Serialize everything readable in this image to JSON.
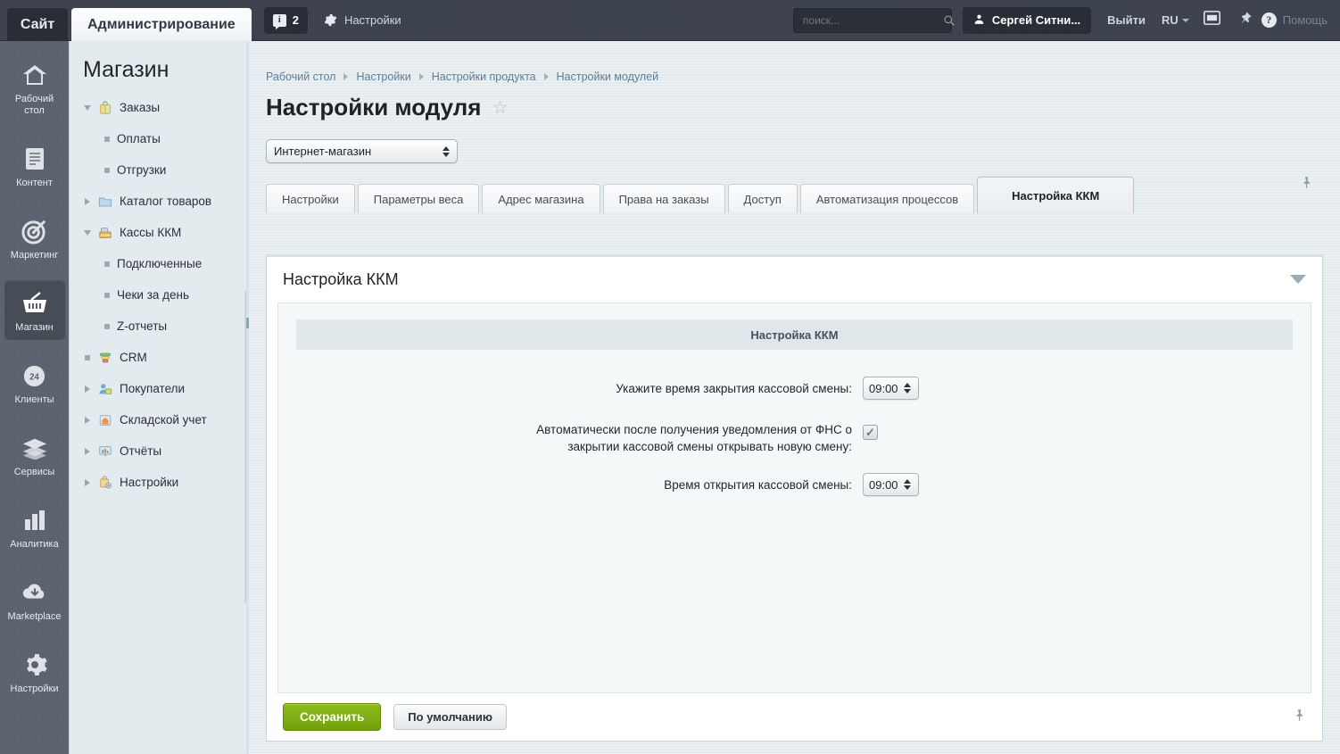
{
  "topbar": {
    "site_tab": "Сайт",
    "admin_tab": "Администрирование",
    "notifications_count": "2",
    "notifications_icon": "info-icon",
    "settings_label": "Настройки",
    "settings_icon": "gear-icon",
    "search_placeholder": "поиск...",
    "search_value": "",
    "search_icon": "search-icon",
    "user_name": "Сергей Ситни...",
    "user_icon": "user-icon",
    "logout_label": "Выйти",
    "language": "RU",
    "panel_icon": "panel-icon",
    "pin_icon": "pin-icon",
    "help_label": "Помощь",
    "help_icon": "question-icon"
  },
  "rail": [
    {
      "label": "Рабочий\nстол",
      "label_line1": "Рабочий",
      "label_line2": "стол",
      "icon": "home-icon",
      "active": false
    },
    {
      "label": "Контент",
      "icon": "document-icon",
      "active": false
    },
    {
      "label": "Маркетинг",
      "icon": "target-icon",
      "active": false
    },
    {
      "label": "Магазин",
      "icon": "basket-icon",
      "active": true
    },
    {
      "label": "Клиенты",
      "icon": "clock-24-icon",
      "active": false
    },
    {
      "label": "Сервисы",
      "icon": "layers-icon",
      "active": false
    },
    {
      "label": "Аналитика",
      "icon": "bar-chart-icon",
      "active": false
    },
    {
      "label": "Marketplace",
      "icon": "cloud-download-icon",
      "active": false
    },
    {
      "label": "Настройки",
      "icon": "gear-icon",
      "active": false
    }
  ],
  "tree": {
    "title": "Магазин",
    "items": [
      {
        "label": "Заказы",
        "level": 0,
        "twisty": "down",
        "icon": "bag-icon"
      },
      {
        "label": "Оплаты",
        "level": 1,
        "twisty": "dot",
        "icon": ""
      },
      {
        "label": "Отгрузки",
        "level": 1,
        "twisty": "dot",
        "icon": ""
      },
      {
        "label": "Каталог товаров",
        "level": 0,
        "twisty": "right",
        "icon": "folder-icon"
      },
      {
        "label": "Кассы ККМ",
        "level": 0,
        "twisty": "down",
        "icon": "cashbox-icon"
      },
      {
        "label": "Подключенные",
        "level": 1,
        "twisty": "dot",
        "icon": ""
      },
      {
        "label": "Чеки за день",
        "level": 1,
        "twisty": "dot",
        "icon": ""
      },
      {
        "label": "Z-отчеты",
        "level": 1,
        "twisty": "dot",
        "icon": ""
      },
      {
        "label": "CRM",
        "level": 0,
        "twisty": "dot",
        "icon": "funnel-icon"
      },
      {
        "label": "Покупатели",
        "level": 0,
        "twisty": "right",
        "icon": "user-lock-icon"
      },
      {
        "label": "Складской учет",
        "level": 0,
        "twisty": "right",
        "icon": "warehouse-icon"
      },
      {
        "label": "Отчёты",
        "level": 0,
        "twisty": "right",
        "icon": "report-icon"
      },
      {
        "label": "Настройки",
        "level": 0,
        "twisty": "right",
        "icon": "bag-gear-icon"
      }
    ]
  },
  "breadcrumb": [
    "Рабочий стол",
    "Настройки",
    "Настройки продукта",
    "Настройки модулей"
  ],
  "page": {
    "title": "Настройки модуля",
    "favorite_icon": "star-icon",
    "module_select_value": "Интернет-магазин",
    "pin_icon": "pin-icon"
  },
  "tabs": [
    {
      "label": "Настройки",
      "active": false
    },
    {
      "label": "Параметры веса",
      "active": false
    },
    {
      "label": "Адрес магазина",
      "active": false
    },
    {
      "label": "Права на заказы",
      "active": false
    },
    {
      "label": "Доступ",
      "active": false
    },
    {
      "label": "Автоматизация процессов",
      "active": false
    },
    {
      "label": "Настройка ККМ",
      "active": true
    }
  ],
  "panel": {
    "heading": "Настройка ККМ",
    "collapse_icon": "chevron-down-icon",
    "section_title": "Настройка ККМ",
    "fields": [
      {
        "label": "Укажите время закрытия кассовой смены:",
        "type": "select",
        "value": "09:00"
      },
      {
        "label": "Автоматически после получения уведомления от ФНС о закрытии кассовой смены открывать новую смену:",
        "label_line1": "Автоматически после получения уведомления от ФНС о",
        "label_line2": "закрытии кассовой смены открывать новую смену:",
        "type": "checkbox",
        "checked": true,
        "check_glyph": "✓"
      },
      {
        "label": "Время открытия кассовой смены:",
        "type": "select",
        "value": "09:00"
      }
    ]
  },
  "actions": {
    "save_label": "Сохранить",
    "default_label": "По умолчанию",
    "pin_icon": "pin-icon"
  },
  "colors": {
    "topbar_bg": "#3b414c",
    "rail_bg": "#5b636e",
    "tree_bg": "#e3ebee",
    "main_bg": "#e4ebee",
    "save_green": "#7eae13",
    "link_blue": "#5c7d96"
  }
}
